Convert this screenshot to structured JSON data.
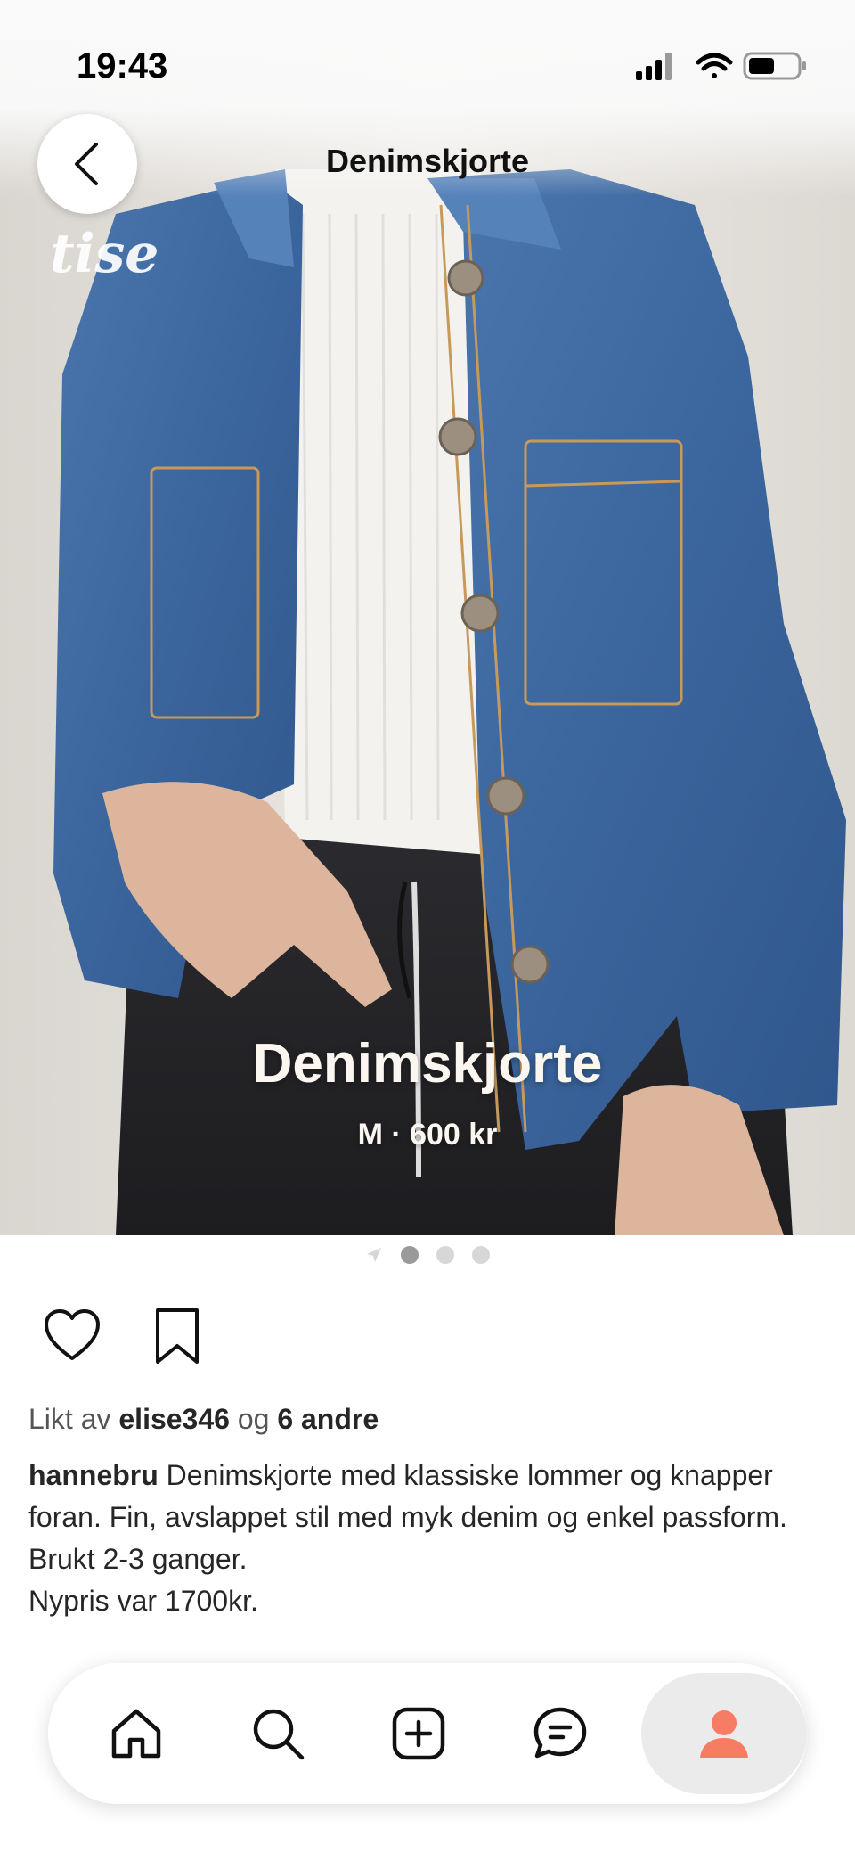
{
  "status_bar": {
    "time": "19:43",
    "icons": [
      "signal-icon",
      "wifi-icon",
      "battery-icon"
    ]
  },
  "nav": {
    "title": "Denimskjorte",
    "back_icon": "chevron-left-icon"
  },
  "hero": {
    "watermark": "tise",
    "product_title": "Denimskjorte",
    "product_subtitle": "M · 600 kr",
    "pager": {
      "count": 3,
      "active_index": 0
    }
  },
  "actions": {
    "like_icon": "heart-icon",
    "save_icon": "bookmark-icon"
  },
  "likes": {
    "prefix": "Likt av",
    "user": "elise346",
    "joiner": "og",
    "others": "6 andre"
  },
  "caption": {
    "username": "hannebru",
    "line1": "Denimskjorte med klassiske lommer og knapper foran. Fin, avslappet stil med myk denim og enkel passform.",
    "line2": "Brukt 2-3 ganger.",
    "line3": "Nypris var 1700kr."
  },
  "tab_bar": {
    "items": [
      {
        "icon": "home-icon"
      },
      {
        "icon": "search-icon"
      },
      {
        "icon": "add-icon"
      },
      {
        "icon": "chat-icon"
      },
      {
        "icon": "profile-icon",
        "active": true
      }
    ],
    "accent": "#f77c64"
  },
  "colors": {
    "denim": "#3e6aa3",
    "background": "#ffffff",
    "text": "#262626"
  }
}
